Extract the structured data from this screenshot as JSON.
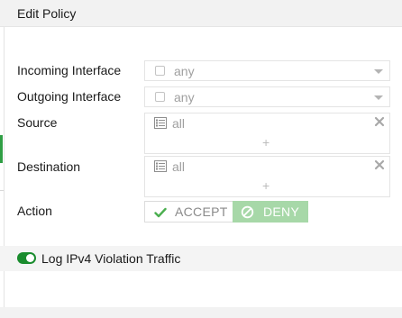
{
  "dialog": {
    "title": "Edit Policy"
  },
  "fields": {
    "incoming_interface": {
      "label": "Incoming Interface",
      "value": "any"
    },
    "outgoing_interface": {
      "label": "Outgoing Interface",
      "value": "any"
    },
    "source": {
      "label": "Source",
      "value": "all",
      "add_symbol": "+"
    },
    "destination": {
      "label": "Destination",
      "value": "all",
      "add_symbol": "+"
    },
    "action": {
      "label": "Action",
      "options": [
        "ACCEPT",
        "DENY"
      ],
      "selected": "DENY"
    }
  },
  "logging": {
    "label": "Log IPv4 Violation Traffic",
    "enabled": true
  },
  "colors": {
    "accent_green": "#1a8c2e",
    "deny_active": "#a7d8a8",
    "accept_check": "#4caf50"
  }
}
